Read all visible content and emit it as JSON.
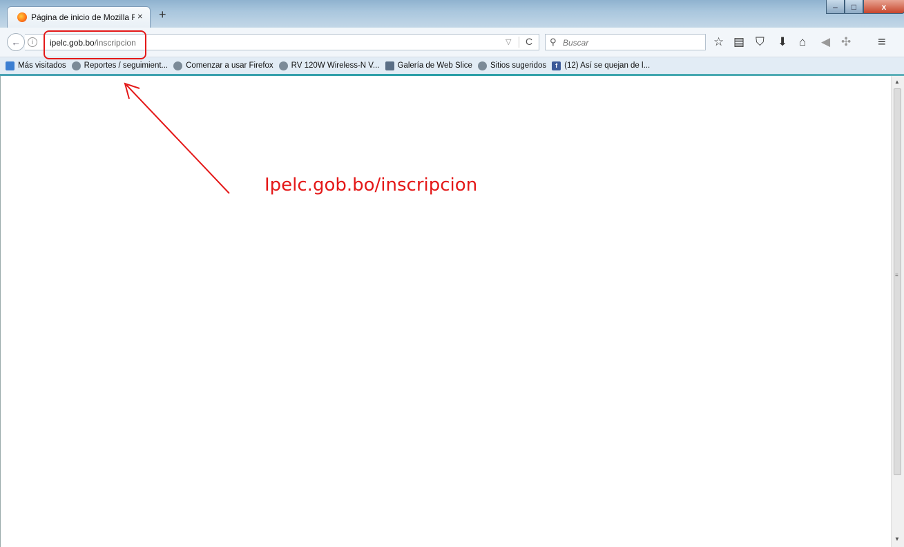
{
  "window": {
    "tab_title": "Página de inicio de Mozilla Fi",
    "tab_close": "×",
    "new_tab": "+",
    "minimize": "–",
    "maximize": "□",
    "close": "x"
  },
  "navbar": {
    "back": "←",
    "info": "i",
    "url_domain": "ipelc.gob.bo",
    "url_path": "/inscripcion",
    "dropdown": "▽",
    "reload": "C",
    "search_icon": "⚲",
    "search_placeholder": "Buscar",
    "tools": {
      "bookmark_star": "☆",
      "reading_list": "▤",
      "pocket": "⛉",
      "downloads": "⬇",
      "home": "⌂",
      "share": "◀",
      "extensions": "✣",
      "menu": "≡"
    }
  },
  "bookmarks": [
    {
      "label": "Más visitados",
      "icon": "most-visited-icon"
    },
    {
      "label": "Reportes / seguimient...",
      "icon": "globe-icon"
    },
    {
      "label": "Comenzar a usar Firefox",
      "icon": "globe-icon"
    },
    {
      "label": "RV 120W Wireless-N V...",
      "icon": "globe-icon"
    },
    {
      "label": "Galería de Web Slice",
      "icon": "webslice-icon"
    },
    {
      "label": "Sitios sugeridos",
      "icon": "globe-icon"
    },
    {
      "label": "(12) Así se quejan de l...",
      "icon": "facebook-icon"
    }
  ],
  "annotation": {
    "label": "Ipelc.gob.bo/inscripcion",
    "color": "#e41818"
  },
  "scrollbar": {
    "up": "▲",
    "grip": "≡",
    "down": "▼"
  }
}
